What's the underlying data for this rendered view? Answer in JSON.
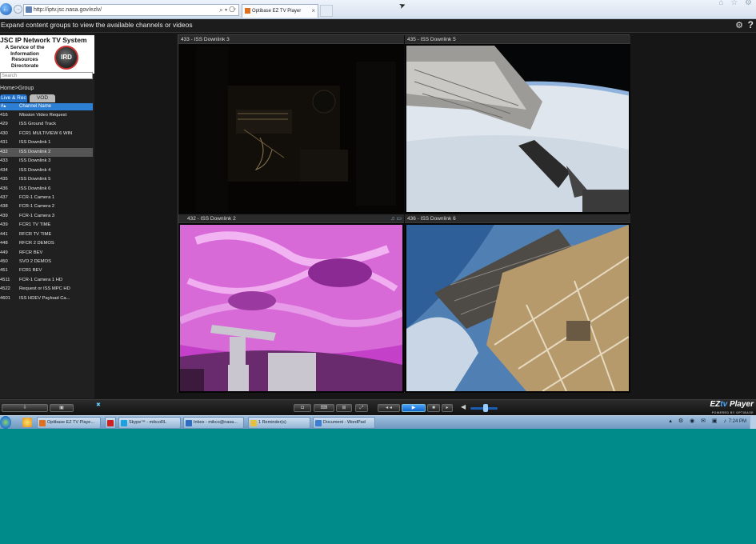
{
  "browser": {
    "url": "http://iptv.jsc.nasa.gov/ezlv/",
    "tab_title": "Optibase EZ TV Player",
    "url_tools": "⌕ ▾ ⟳",
    "tab_close": "×",
    "window_controls": "⌂ ☆ ⚙"
  },
  "header": {
    "hint": "Expand content groups to view the available channels or videos"
  },
  "sidebar": {
    "logo_title": "JSC IP Network TV System",
    "logo_lines": [
      "A Service of the",
      "Information",
      "Resources",
      "Directorate"
    ],
    "logo_badge": "IRD",
    "search_placeholder": "Search",
    "breadcrumb": "Home>Group",
    "tabs": [
      "Live & Rec",
      "VOD"
    ],
    "list_header": {
      "num": "#▴",
      "name": "Channel Name"
    },
    "channels": [
      {
        "num": "416",
        "name": "Mission Video Request"
      },
      {
        "num": "429",
        "name": "ISS Ground Track"
      },
      {
        "num": "430",
        "name": "FCR1 MULTIVIEW 6 WIN"
      },
      {
        "num": "431",
        "name": "ISS Downlink 1"
      },
      {
        "num": "432",
        "name": "ISS Downlink 2"
      },
      {
        "num": "433",
        "name": "ISS Downlink 3"
      },
      {
        "num": "434",
        "name": "ISS Downlink 4"
      },
      {
        "num": "435",
        "name": "ISS Downlink 5"
      },
      {
        "num": "436",
        "name": "ISS Downlink 6"
      },
      {
        "num": "437",
        "name": "FCR-1 Camera 1"
      },
      {
        "num": "438",
        "name": "FCR-1 Camera 2"
      },
      {
        "num": "439",
        "name": "FCR-1 Camera 3"
      },
      {
        "num": "439",
        "name": "FCR1 TV TIME"
      },
      {
        "num": "441",
        "name": "RFCR TV TIME"
      },
      {
        "num": "448",
        "name": "RFCR 2 DEMOS"
      },
      {
        "num": "449",
        "name": "RFCR BEV"
      },
      {
        "num": "450",
        "name": "SVO 2 DEMOS"
      },
      {
        "num": "451",
        "name": "FCR1 BEV"
      },
      {
        "num": "4511",
        "name": "FCR-1 Camera 1 HD"
      },
      {
        "num": "4522",
        "name": "Request or ISS MPC HD"
      },
      {
        "num": "4601",
        "name": "ISS HDEV Payload Ca..."
      }
    ],
    "selected_index": 4
  },
  "videos": [
    {
      "title": "433 - ISS Downlink 3"
    },
    {
      "title": "435 - ISS Downlink 5"
    },
    {
      "title": "432 - ISS Downlink 2",
      "icons": "♫ ▭"
    },
    {
      "title": "436 - ISS Downlink 6"
    }
  ],
  "controls": {
    "down": "⇩",
    "save": "▣",
    "x": "✖",
    "snap": "◘",
    "ptz": "⌨",
    "layout": "⊞",
    "full": "⤢",
    "prev": "◂ ◂",
    "play": "▶",
    "stop": "■",
    "next": "▸",
    "volume_icon": "◀",
    "volume_level": 0.55,
    "brand_ez": "EZ",
    "brand_tv": "tv",
    "brand_player": " Player",
    "brand_sub": "POWERED BY OPTIBASE"
  },
  "taskbar": {
    "items": [
      "Optibase EZ TV Playe...",
      "Skype™ - mikcoRL",
      "Inbox - mikco@nasa...",
      "1 Reminder(s)",
      "Document - WordPad"
    ],
    "tray": "▴ ⚙ ◉ ✉ ▣ ♪",
    "clock": "7:24 PM"
  },
  "colors": {
    "accent": "#2d7fd3",
    "desktop": "#008b8b"
  }
}
